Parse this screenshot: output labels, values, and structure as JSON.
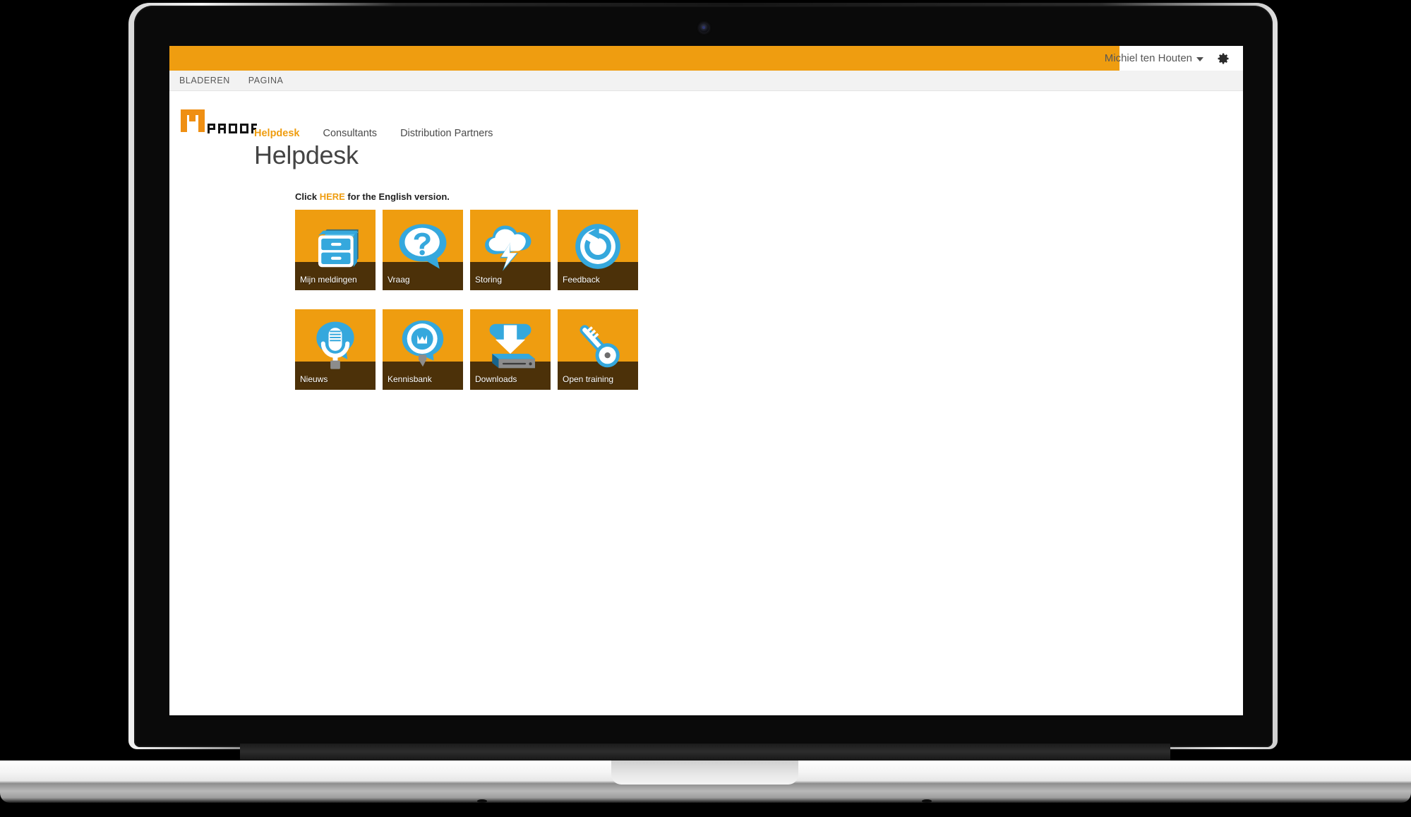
{
  "device": {
    "type": "laptop-mockup",
    "webcam_icon": "webcam-dot"
  },
  "suite_bar": {
    "bar_color": "#ef9d10",
    "user_name": "Michiel ten Houten",
    "user_menu_caret_icon": "chevron-down-icon",
    "settings_icon": "gear-icon"
  },
  "ribbon": {
    "tabs": [
      {
        "label": "BLADEREN"
      },
      {
        "label": "PAGINA"
      }
    ]
  },
  "site_header": {
    "logo": {
      "icon": "m-proof-logo",
      "mark_text": "M",
      "word_text": "PROOF",
      "mark_color": "#ef8f13",
      "word_color": "#1a1a1a"
    },
    "nav": [
      {
        "label": "Helpdesk",
        "active": true
      },
      {
        "label": "Consultants",
        "active": false
      },
      {
        "label": "Distribution Partners",
        "active": false
      }
    ],
    "page_title": "Helpdesk"
  },
  "content": {
    "english_note": {
      "before": "Click ",
      "link": "HERE",
      "after": " for the English version."
    },
    "tiles": [
      {
        "label": "Mijn meldingen",
        "icon": "filing-cabinet-icon"
      },
      {
        "label": "Vraag",
        "icon": "question-speech-bubble-icon"
      },
      {
        "label": "Storing",
        "icon": "storm-cloud-lightning-icon"
      },
      {
        "label": "Feedback",
        "icon": "circular-arrow-refresh-icon"
      },
      {
        "label": "Nieuws",
        "icon": "microphone-icon"
      },
      {
        "label": "Kennisbank",
        "icon": "lightbulb-icon"
      },
      {
        "label": "Downloads",
        "icon": "download-arrow-drive-icon"
      },
      {
        "label": "Open training",
        "icon": "key-icon"
      }
    ],
    "tile_colors": {
      "background": "#ef9d10",
      "bottom_band": "#4c3109",
      "art_primary": "#35a8dd",
      "art_white": "#ffffff",
      "art_dark": "#18658c"
    }
  }
}
